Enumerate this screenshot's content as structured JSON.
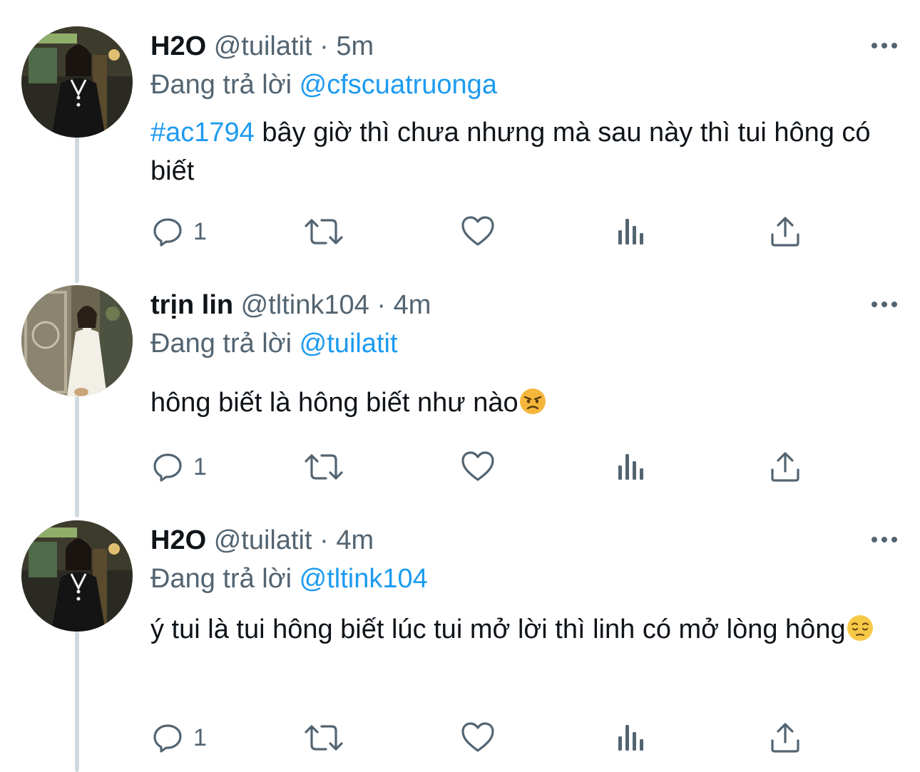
{
  "tweets": [
    {
      "display_name": "H2O",
      "handle": "@tuilatit",
      "separator": "·",
      "time": "5m",
      "replying_prefix": "Đang trả lời",
      "replying_to": "@cfscuatruonga",
      "hashtag": "#ac1794",
      "text": " bây giờ thì chưa nhưng mà sau này thì tui hông có biết",
      "reply_count": "1",
      "avatar": "user-photo-black-dress"
    },
    {
      "display_name": "trịn lin",
      "handle": "@tltink104",
      "separator": "·",
      "time": "4m",
      "replying_prefix": "Đang trả lời",
      "replying_to": "@tuilatit",
      "text": "hông biết là hông biết như nào",
      "emoji": "angry-face-emoji",
      "reply_count": "1",
      "avatar": "user-photo-white-dress"
    },
    {
      "display_name": "H2O",
      "handle": "@tuilatit",
      "separator": "·",
      "time": "4m",
      "replying_prefix": "Đang trả lời",
      "replying_to": "@tltink104",
      "text": "ý tui là tui hông biết lúc tui mở lời thì linh có mở lòng hông",
      "emoji": "pensive-face-emoji",
      "reply_count": "1",
      "avatar": "user-photo-black-dress"
    }
  ],
  "icons": {
    "reply": "reply-icon",
    "retweet": "retweet-icon",
    "like": "heart-icon",
    "views": "views-icon",
    "share": "share-icon",
    "more": "more-icon"
  },
  "colors": {
    "link": "#1d9bf0",
    "secondary_text": "#536471",
    "primary_text": "#0f1419",
    "thread_line": "#cfd9de"
  }
}
